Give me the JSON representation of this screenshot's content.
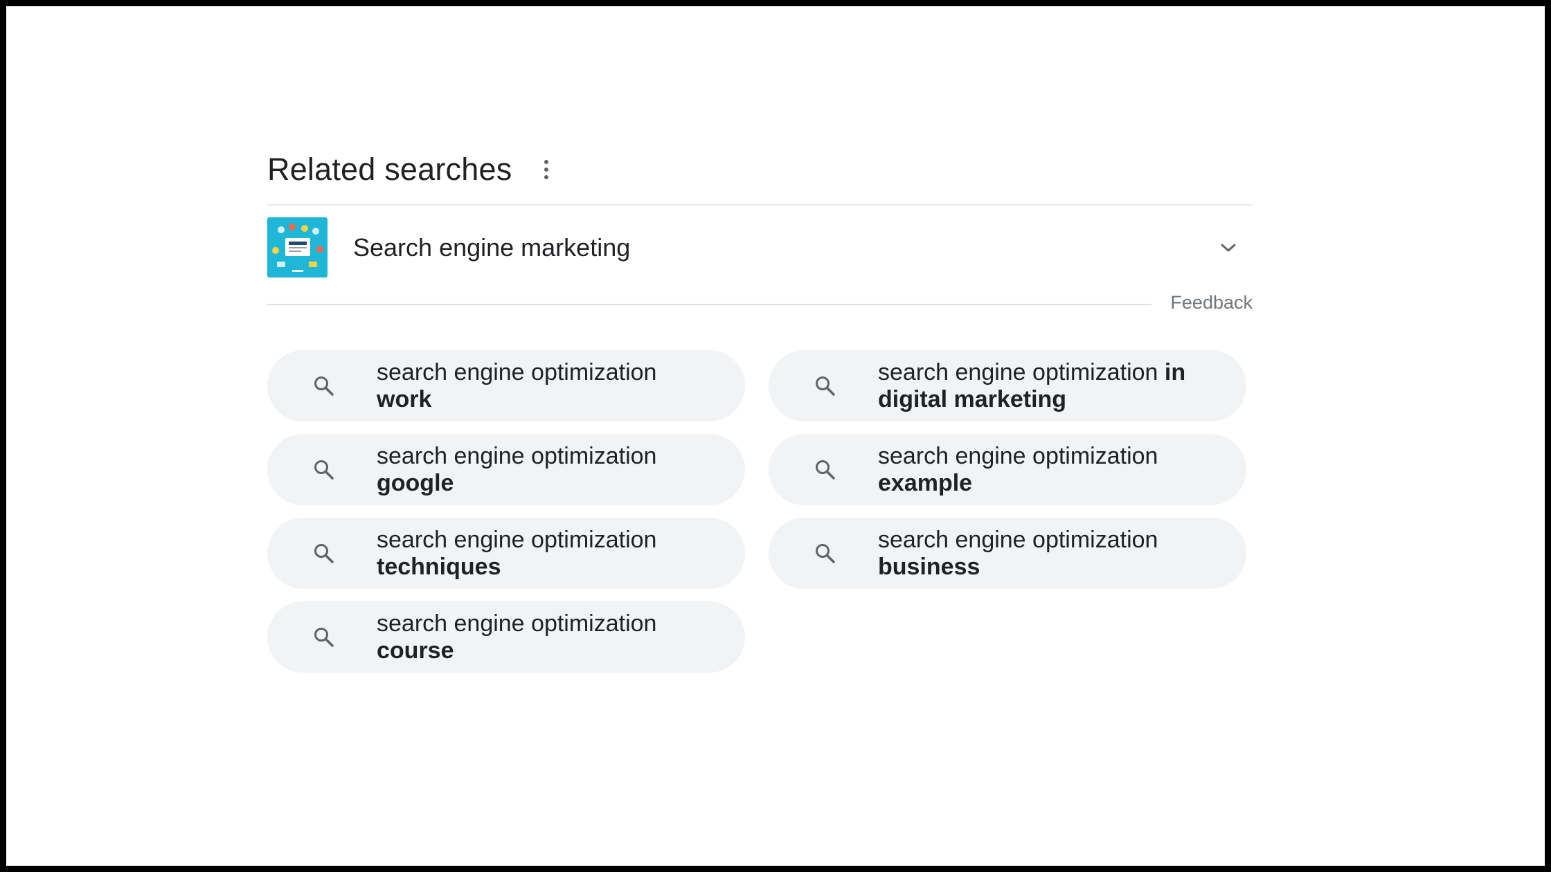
{
  "related": {
    "title": "Related searches",
    "entity": {
      "label": "Search engine marketing"
    },
    "feedback": "Feedback",
    "suggestions": [
      {
        "prefix": "search engine optimization",
        "inline": "",
        "bold": "work"
      },
      {
        "prefix": "search engine optimization",
        "inline": "in",
        "bold": "digital marketing"
      },
      {
        "prefix": "search engine optimization",
        "inline": "",
        "bold": "google"
      },
      {
        "prefix": "search engine optimization",
        "inline": "",
        "bold": "example"
      },
      {
        "prefix": "search engine optimization",
        "inline": "",
        "bold": "techniques"
      },
      {
        "prefix": "search engine optimization",
        "inline": "",
        "bold": "business"
      },
      {
        "prefix": "search engine optimization",
        "inline": "",
        "bold": "course"
      }
    ]
  },
  "icons": {
    "more": "more-vert-icon",
    "chevron": "chevron-down-icon",
    "search": "search-icon"
  },
  "colors": {
    "chip_background": "#f1f3f4",
    "text": "#202124",
    "muted": "#70757a",
    "thumbnail": "#1fb6d8"
  }
}
